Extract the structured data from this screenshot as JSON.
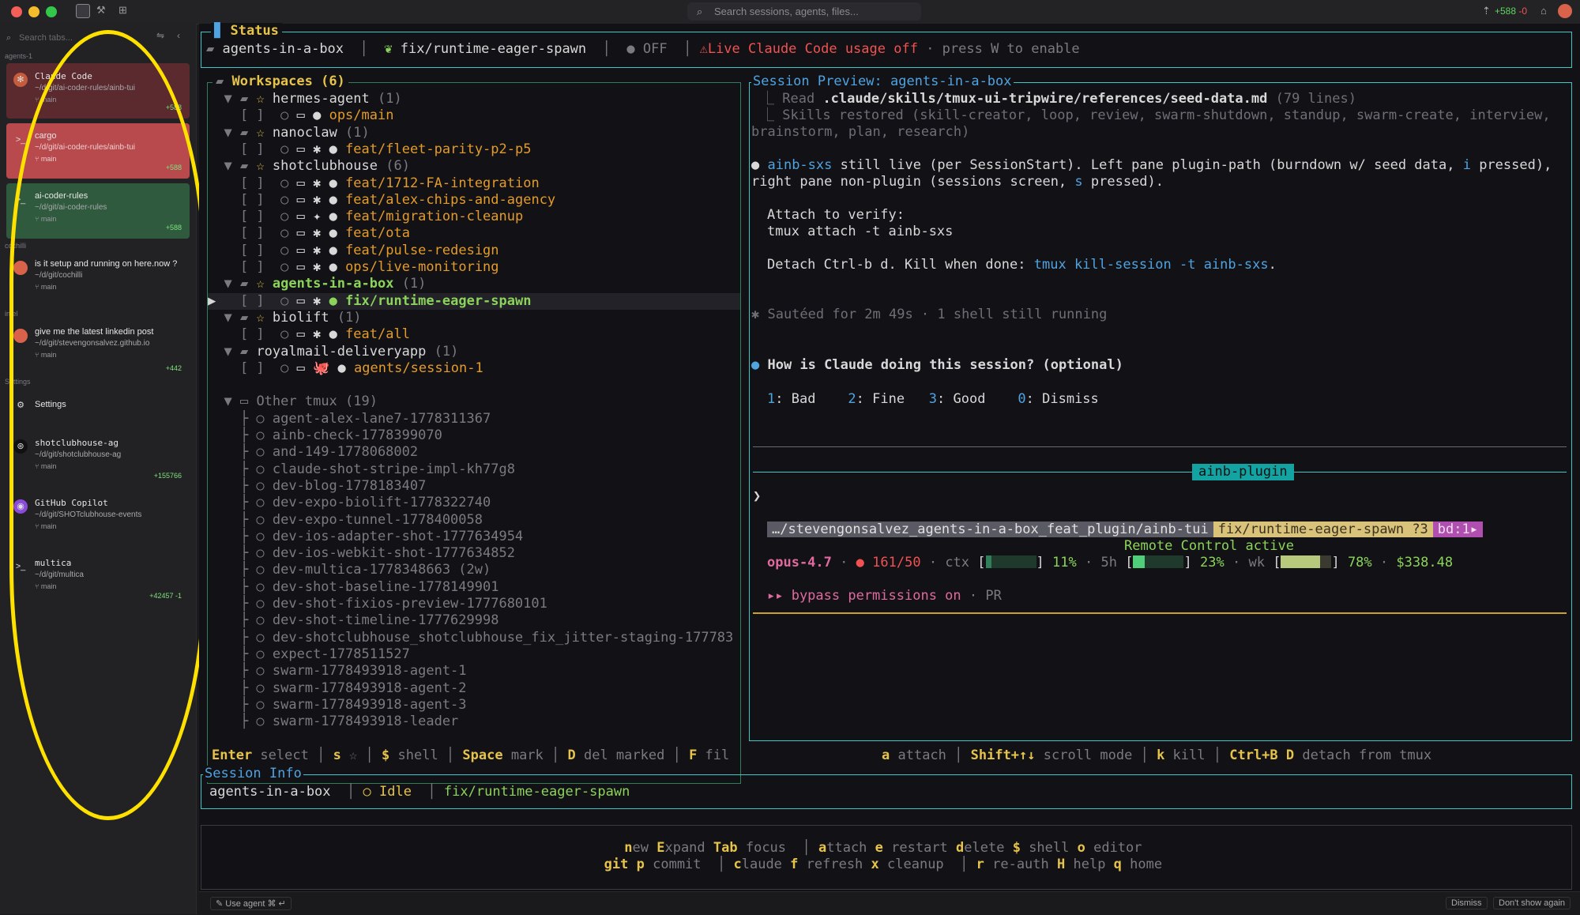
{
  "topbar": {
    "search_placeholder": "Search sessions, agents, files...",
    "diff_plus": "+588",
    "diff_minus": "-0"
  },
  "sidebar": {
    "search_placeholder": "Search tabs...",
    "group_agents": "agents-1",
    "group_cochilli": "cochilli",
    "group_intel": "intel",
    "group_settings": "Settings",
    "cards": [
      {
        "title": "Claude Code",
        "path": "~/d/git/ai-coder-rules/ainb-tui",
        "branch": "main",
        "count": "+588",
        "bg": "#5a2a2e"
      },
      {
        "title": "cargo",
        "path": "~/d/git/ai-coder-rules/ainb-tui",
        "branch": "main",
        "count": "+588",
        "bg": "#b84a4e"
      },
      {
        "title": "ai-coder-rules",
        "path": "~/d/git/ai-coder-rules",
        "branch": "main",
        "count": "+588",
        "bg": "#2f5a3e"
      },
      {
        "title": "is it setup and running on here.now ?",
        "path": "~/d/git/cochilli",
        "branch": "main",
        "count": "",
        "bg": "#222225"
      },
      {
        "title": "give me the latest linkedin post",
        "path": "~/d/git/stevengonsalvez.github.io",
        "branch": "main",
        "count": "+442",
        "bg": "#222225"
      },
      {
        "title": "shotclubhouse-ag",
        "path": "~/d/git/shotclubhouse-ag",
        "branch": "main",
        "count": "+155766",
        "bg": "#222225"
      },
      {
        "title": "GitHub Copilot",
        "path": "~/d/git/SHOTclubhouse-events",
        "branch": "main",
        "count": "",
        "bg": "#222225"
      },
      {
        "title": "multica",
        "path": "~/d/git/multica",
        "branch": "main",
        "count": "+42457 -1",
        "bg": "#222225"
      }
    ],
    "settings_label": "Settings"
  },
  "status": {
    "title": "Status",
    "session": "agents-in-a-box",
    "branch": "fix/runtime-eager-spawn",
    "toggle": "OFF",
    "warning": "Live Claude Code usage off",
    "hint": "· press W to enable"
  },
  "workspaces": {
    "title": "Workspaces (6)",
    "rows": [
      {
        "indent": 0,
        "text": "hermes-agent",
        "count": "(1)",
        "kind": "ws",
        "star": true
      },
      {
        "indent": 1,
        "text": "ops/main",
        "kind": "br",
        "color": "o",
        "mark": ""
      },
      {
        "indent": 0,
        "text": "nanoclaw",
        "count": "(1)",
        "kind": "ws",
        "star": true
      },
      {
        "indent": 1,
        "text": "feat/fleet-parity-p2-p5",
        "kind": "br",
        "color": "o",
        "mark": "✱"
      },
      {
        "indent": 0,
        "text": "shotclubhouse",
        "count": "(6)",
        "kind": "ws",
        "star": true
      },
      {
        "indent": 1,
        "text": "feat/1712-FA-integration",
        "kind": "br",
        "color": "o",
        "mark": "✱"
      },
      {
        "indent": 1,
        "text": "feat/alex-chips-and-agency",
        "kind": "br",
        "color": "o",
        "mark": "✱"
      },
      {
        "indent": 1,
        "text": "feat/migration-cleanup",
        "kind": "br",
        "color": "o",
        "mark": "✦"
      },
      {
        "indent": 1,
        "text": "feat/ota",
        "kind": "br",
        "color": "o",
        "mark": "✱"
      },
      {
        "indent": 1,
        "text": "feat/pulse-redesign",
        "kind": "br",
        "color": "o",
        "mark": "✱"
      },
      {
        "indent": 1,
        "text": "ops/live-monitoring",
        "kind": "br",
        "color": "o",
        "mark": "✱"
      },
      {
        "indent": 0,
        "text": "agents-in-a-box",
        "count": "(1)",
        "kind": "ws",
        "star": true,
        "active": true
      },
      {
        "indent": 1,
        "text": "fix/runtime-eager-spawn",
        "kind": "br",
        "color": "g",
        "mark": "✱",
        "selected": true
      },
      {
        "indent": 0,
        "text": "biolift",
        "count": "(1)",
        "kind": "ws",
        "star": true
      },
      {
        "indent": 1,
        "text": "feat/all",
        "kind": "br",
        "color": "o",
        "mark": "✱"
      },
      {
        "indent": 0,
        "text": "royalmail-deliveryapp",
        "count": "(1)",
        "kind": "ws",
        "star": false
      },
      {
        "indent": 1,
        "text": "agents/session-1",
        "kind": "br",
        "color": "o",
        "mark": "🐙"
      }
    ],
    "other_title": "Other tmux",
    "other_count": "(19)",
    "other": [
      "agent-alex-lane7-1778311367",
      "ainb-check-1778399070",
      "and-149-1778068002",
      "claude-shot-stripe-impl-kh77g8",
      "dev-blog-1778183407",
      "dev-expo-biolift-1778322740",
      "dev-expo-tunnel-1778400058",
      "dev-ios-adapter-shot-1777634954",
      "dev-ios-webkit-shot-1777634852",
      "dev-multica-1778348663 (2w)",
      "dev-shot-baseline-1778149901",
      "dev-shot-fixios-preview-1777680101",
      "dev-shot-timeline-1777629998",
      "dev-shotclubhouse_shotclubhouse_fix_jitter-staging-177783",
      "expect-1778511527",
      "swarm-1778493918-agent-1",
      "swarm-1778493918-agent-2",
      "swarm-1778493918-agent-3",
      "swarm-1778493918-leader"
    ]
  },
  "preview": {
    "title": "Session Preview: agents-in-a-box",
    "read_prefix": "Read ",
    "read_path": ".claude/skills/tmux-ui-tripwire/references/seed-data.md",
    "read_suffix": " (79 lines)",
    "skills_line1": "Skills restored (skill-creator, loop, review, swarm-shutdown, standup, swarm-create, interview,",
    "skills_line2": "brainstorm, plan, research)",
    "live_1a": "ainb-sxs",
    "live_1b": " still live (per SessionStart). Left pane plugin-path (burndown w/ seed data, ",
    "live_1c": "i",
    "live_1d": " pressed),",
    "live_2a": "right pane non-plugin (sessions screen, ",
    "live_2b": "s",
    "live_2c": " pressed).",
    "attach_1": "Attach to verify:",
    "attach_2": "tmux attach -t ainb-sxs",
    "detach_a": "Detach Ctrl-b d. Kill when done: ",
    "detach_b": "tmux kill-session -t ainb-sxs",
    "detach_c": ".",
    "sauteed": "✱ Sautéed for 2m 49s · 1 shell still running",
    "question": "How is Claude doing this session? (optional)",
    "r1k": "1",
    "r1": ": Bad",
    "r2k": "2",
    "r2": ": Fine",
    "r3k": "3",
    "r3": ": Good",
    "r0k": "0",
    "r0": ": Dismiss",
    "plugin_tag": "ainb-plugin",
    "prompt": "❯",
    "pl_path": "…/stevengonsalvez_agents-in-a-box_feat_plugin/ainb-tui",
    "pl_branch": "fix/runtime-eager-spawn ?3",
    "pl_bd": "bd:1▸",
    "remote": "Remote Control active",
    "model": "opus-4.7",
    "ctx_count": "161/50",
    "ctx_label": "ctx",
    "ctx_pct": "11%",
    "h5_label": "5h",
    "h5_pct": "23%",
    "wk_label": "wk",
    "wk_pct": "78%",
    "cost": "$338.48",
    "bypass": "▸▸ bypass permissions on",
    "bypass_sep": " · ",
    "pr": "PR",
    "ctx_fill": 0.11,
    "h5_fill": 0.23,
    "wk_fill": 0.78
  },
  "keys_left": [
    {
      "k": "Enter",
      "d": "select"
    },
    {
      "k": "s",
      "d": "☆"
    },
    {
      "k": "$",
      "d": "shell"
    },
    {
      "k": "Space",
      "d": "mark"
    },
    {
      "k": "D",
      "d": "del marked"
    },
    {
      "k": "F",
      "d": "fil"
    }
  ],
  "keys_right": [
    {
      "k": "a",
      "d": "attach"
    },
    {
      "k": "Shift+↑↓",
      "d": "scroll mode"
    },
    {
      "k": "k",
      "d": "kill"
    },
    {
      "k": "Ctrl+B D",
      "d": "detach from tmux"
    }
  ],
  "session_info": {
    "title": "Session Info",
    "name": "agents-in-a-box",
    "state": "○ Idle",
    "branch": "fix/runtime-eager-spawn"
  },
  "help": {
    "line1": [
      {
        "k": "n",
        "d": "ew"
      },
      {
        "k": "E",
        "d": "xpand"
      },
      {
        "k": "Tab",
        "d": " focus"
      },
      {
        "sep": true
      },
      {
        "k": "a",
        "d": "ttach"
      },
      {
        "k": "e",
        "d": " restart"
      },
      {
        "k": "d",
        "d": "elete"
      },
      {
        "k": "$",
        "d": " shell"
      },
      {
        "k": "o",
        "d": " editor"
      }
    ],
    "line2": [
      {
        "k": "git",
        "d": ""
      },
      {
        "k": "p",
        "d": " commit"
      },
      {
        "sep": true
      },
      {
        "k": "c",
        "d": "laude"
      },
      {
        "k": "f",
        "d": " refresh"
      },
      {
        "k": "x",
        "d": " cleanup"
      },
      {
        "sep": true
      },
      {
        "k": "r",
        "d": " re-auth"
      },
      {
        "k": "H",
        "d": " help"
      },
      {
        "k": "q",
        "d": " home"
      }
    ]
  },
  "footer": {
    "use_agent": "Use agent",
    "dismiss": "Dismiss",
    "dont_show": "Don't show again"
  },
  "colors": {
    "accent_orange": "#e39b2a",
    "accent_green": "#8bd35a",
    "highlight_yellow": "#ffe100",
    "plugin_teal": "#14a3a3"
  }
}
